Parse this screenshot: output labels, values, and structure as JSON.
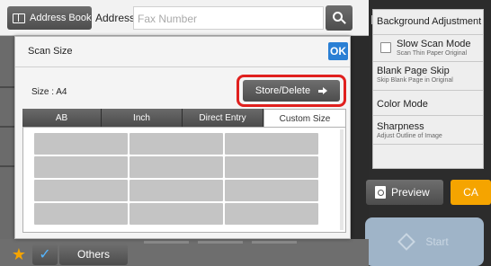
{
  "header": {
    "address_book_label": "Address Book",
    "address_label": "Address",
    "fax_placeholder": "Fax Number"
  },
  "dialog": {
    "title": "Scan Size",
    "ok_label": "OK",
    "size_label": "Size : A4",
    "store_delete_label": "Store/Delete",
    "tabs": [
      {
        "label": "AB",
        "active": false
      },
      {
        "label": "Inch",
        "active": false
      },
      {
        "label": "Direct Entry",
        "active": false
      },
      {
        "label": "Custom Size",
        "active": true
      }
    ]
  },
  "right_panel": {
    "items": [
      {
        "title": "Background Adjustment",
        "sub": ""
      },
      {
        "title": "Slow Scan Mode",
        "sub": "Scan Thin Paper Original"
      },
      {
        "title": "Blank Page Skip",
        "sub": "Skip Blank Page in Original"
      },
      {
        "title": "Color Mode",
        "sub": ""
      },
      {
        "title": "Sharpness",
        "sub": "Adjust Outline of Image"
      }
    ],
    "preview_label": "Preview",
    "ca_label": "CA",
    "start_label": "Start"
  },
  "bottom": {
    "others_label": "Others"
  },
  "colors": {
    "accent_ok": "#2a7fd4",
    "highlight_frame": "#e0201e",
    "ca_orange": "#f5a400",
    "star": "#f5a400"
  }
}
